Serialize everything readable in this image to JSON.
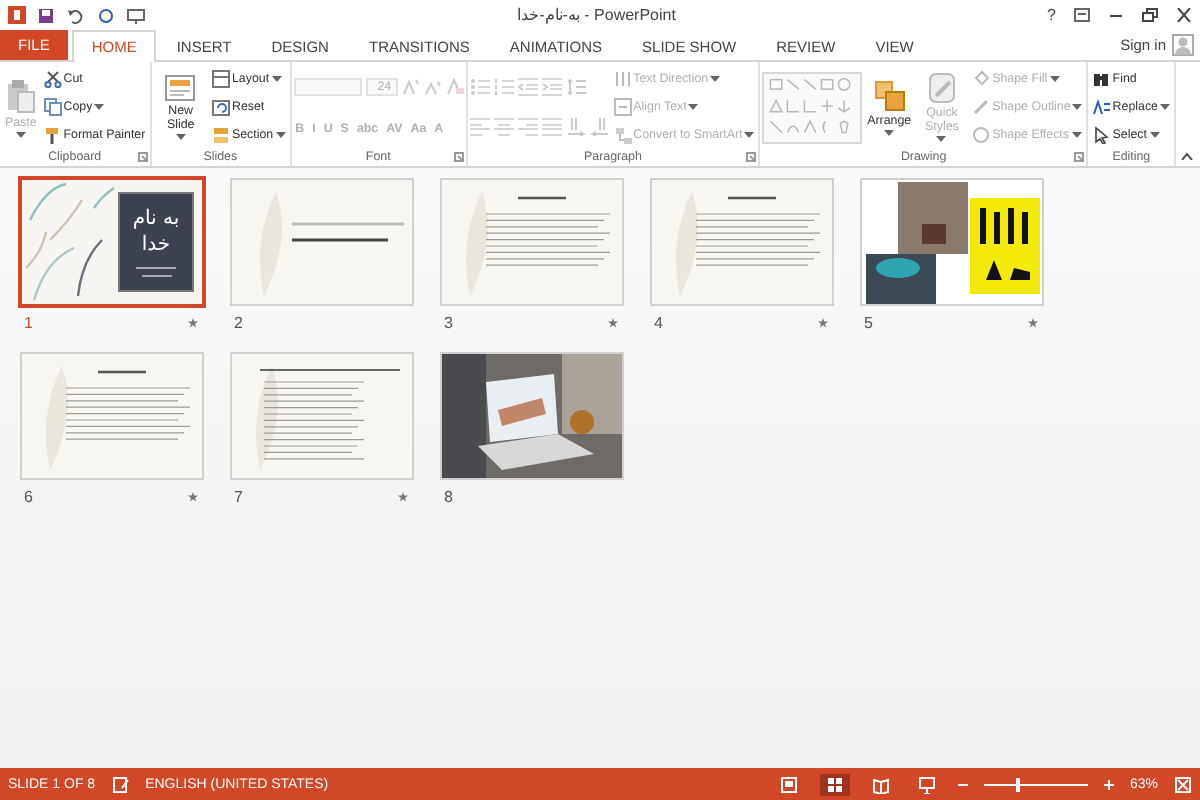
{
  "window": {
    "title": "به-نام-خدا - PowerPoint",
    "help": "?",
    "sign_in": "Sign in"
  },
  "tabs": [
    {
      "label": "FILE",
      "kind": "file",
      "selected": false
    },
    {
      "label": "HOME",
      "kind": "tab",
      "selected": true
    },
    {
      "label": "INSERT",
      "kind": "tab",
      "selected": false
    },
    {
      "label": "DESIGN",
      "kind": "tab",
      "selected": false
    },
    {
      "label": "TRANSITIONS",
      "kind": "tab",
      "selected": false
    },
    {
      "label": "ANIMATIONS",
      "kind": "tab",
      "selected": false
    },
    {
      "label": "SLIDE SHOW",
      "kind": "tab",
      "selected": false
    },
    {
      "label": "REVIEW",
      "kind": "tab",
      "selected": false
    },
    {
      "label": "VIEW",
      "kind": "tab",
      "selected": false
    }
  ],
  "ribbon": {
    "groups": [
      {
        "label": "Clipboard",
        "columns": [
          [
            {
              "kind": "large",
              "label": "Paste",
              "disabled": true
            }
          ],
          [
            {
              "kind": "small",
              "label": "Cut",
              "disabled": false
            },
            {
              "kind": "small",
              "label": "Copy",
              "disabled": false
            },
            {
              "kind": "small",
              "label": "Format Painter",
              "disabled": false
            }
          ]
        ]
      },
      {
        "label": "Slides",
        "columns": [
          [
            {
              "kind": "large",
              "label": "New Slide",
              "disabled": false
            }
          ],
          [
            {
              "kind": "small",
              "label": "Layout",
              "disabled": false
            },
            {
              "kind": "small",
              "label": "Reset",
              "disabled": false
            },
            {
              "kind": "small",
              "label": "Section",
              "disabled": false
            }
          ]
        ]
      },
      {
        "label": "Font",
        "columns": [
          [
            {
              "kind": "row",
              "items": [
                {
                  "kind": "field",
                  "disabled": true
                },
                {
                  "kind": "field",
                  "value": "24",
                  "disabled": true
                },
                {
                  "kind": "icon",
                  "disabled": true
                },
                {
                  "kind": "icon",
                  "disabled": true
                },
                {
                  "kind": "icon",
                  "disabled": true
                }
              ]
            },
            {
              "kind": "row",
              "items": [
                {
                  "kind": "glyph",
                  "label": "B",
                  "disabled": true
                },
                {
                  "kind": "glyph",
                  "label": "I",
                  "disabled": true
                },
                {
                  "kind": "glyph",
                  "label": "U",
                  "disabled": true
                },
                {
                  "kind": "glyph",
                  "label": "S",
                  "disabled": true
                },
                {
                  "kind": "glyph",
                  "label": "abc",
                  "disabled": true
                },
                {
                  "kind": "glyph",
                  "label": "AV",
                  "disabled": true
                },
                {
                  "kind": "glyph",
                  "label": "Aa",
                  "disabled": true
                },
                {
                  "kind": "glyph",
                  "label": "A",
                  "disabled": true
                }
              ]
            }
          ]
        ]
      },
      {
        "label": "Paragraph",
        "columns": [
          [
            {
              "kind": "row",
              "items": [
                {
                  "kind": "icon",
                  "disabled": true
                },
                {
                  "kind": "icon",
                  "disabled": true
                },
                {
                  "kind": "icon",
                  "disabled": true
                },
                {
                  "kind": "icon",
                  "disabled": true
                },
                {
                  "kind": "icon",
                  "disabled": true
                }
              ]
            },
            {
              "kind": "row",
              "items": [
                {
                  "kind": "icon",
                  "disabled": true
                },
                {
                  "kind": "icon",
                  "disabled": true
                },
                {
                  "kind": "icon",
                  "disabled": true
                },
                {
                  "kind": "icon",
                  "disabled": true
                },
                {
                  "kind": "icon",
                  "disabled": true
                },
                {
                  "kind": "icon",
                  "disabled": true
                }
              ]
            }
          ],
          [
            {
              "kind": "small",
              "label": "Text Direction",
              "disabled": true
            },
            {
              "kind": "small",
              "label": "Align Text",
              "disabled": true
            },
            {
              "kind": "small",
              "label": "Convert to SmartArt",
              "disabled": true
            }
          ]
        ]
      },
      {
        "label": "Drawing",
        "columns": [
          [
            {
              "kind": "gallery",
              "disabled": true
            }
          ],
          [
            {
              "kind": "large",
              "label": "Arrange",
              "disabled": false
            }
          ],
          [
            {
              "kind": "large",
              "label": "Quick Styles",
              "disabled": true
            }
          ],
          [
            {
              "kind": "small",
              "label": "Shape Fill",
              "disabled": true
            },
            {
              "kind": "small",
              "label": "Shape Outline",
              "disabled": true
            },
            {
              "kind": "small",
              "label": "Shape Effects",
              "disabled": true
            }
          ]
        ]
      },
      {
        "label": "Editing",
        "columns": [
          [
            {
              "kind": "small",
              "label": "Find",
              "disabled": false
            },
            {
              "kind": "small",
              "label": "Replace",
              "disabled": false
            },
            {
              "kind": "small",
              "label": "Select",
              "disabled": false
            }
          ]
        ]
      }
    ]
  },
  "slides": [
    {
      "number": "1",
      "kind": "cover",
      "title": "به نام خدا",
      "selected": true,
      "animated": true
    },
    {
      "number": "2",
      "kind": "title",
      "selected": false,
      "animated": false
    },
    {
      "number": "3",
      "kind": "text",
      "selected": false,
      "animated": true
    },
    {
      "number": "4",
      "kind": "text",
      "selected": false,
      "animated": true
    },
    {
      "number": "5",
      "kind": "collage",
      "selected": false,
      "animated": true
    },
    {
      "number": "6",
      "kind": "text",
      "selected": false,
      "animated": true
    },
    {
      "number": "7",
      "kind": "list",
      "selected": false,
      "animated": true
    },
    {
      "number": "8",
      "kind": "photo",
      "selected": false,
      "animated": false
    }
  ],
  "status_bar": {
    "slide": "SLIDE 1 OF 8",
    "language": "ENGLISH (UNITED STATES)",
    "views": [
      {
        "kind": "normal",
        "selected": false
      },
      {
        "kind": "sorter",
        "selected": true
      },
      {
        "kind": "reading",
        "selected": false
      },
      {
        "kind": "show",
        "selected": false
      }
    ],
    "zoom": {
      "level": 0.32,
      "reading": "63%"
    }
  }
}
